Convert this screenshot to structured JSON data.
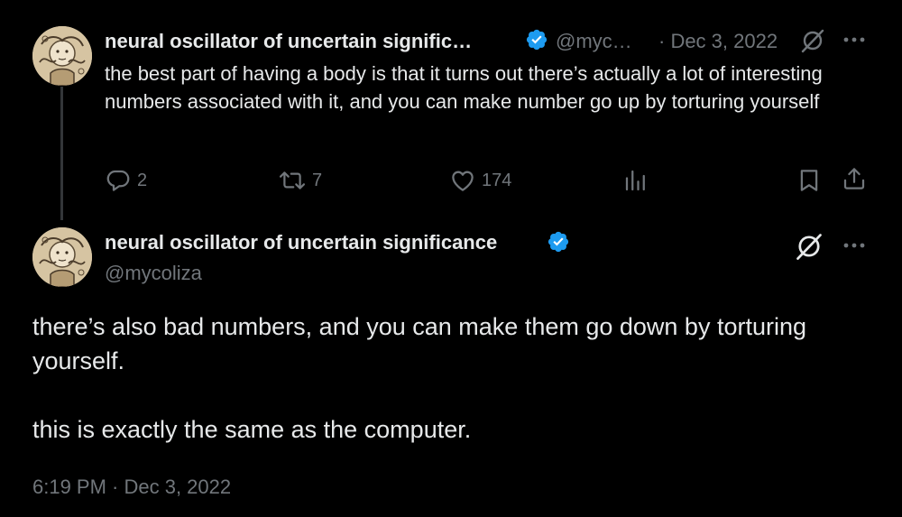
{
  "parent_tweet": {
    "display_name": "neural oscillator of uncertain signific…",
    "handle": "@myc…",
    "date": "· Dec 3, 2022",
    "text": "the best part of having a body is that it turns out there’s actually a lot of interesting numbers associated with it, and you can make number go up by torturing yourself",
    "replies": "2",
    "retweets": "7",
    "likes": "174",
    "views": ""
  },
  "main_tweet": {
    "display_name": "neural oscillator of uncertain significance",
    "handle": "@mycoliza",
    "paragraphs": [
      "there’s also bad numbers, and you can make them go down by torturing yourself.",
      "this is exactly the same as the computer."
    ],
    "timestamp": "6:19 PM · Dec 3, 2022"
  },
  "colors": {
    "background": "#000000",
    "text_primary": "#e7e9ea",
    "text_secondary": "#71767b",
    "verified": "#1d9bf0",
    "thread_line": "#333639"
  },
  "icons": {
    "verified": "verified-badge-icon",
    "grok": "grok-icon",
    "more": "more-icon",
    "reply": "reply-icon",
    "retweet": "retweet-icon",
    "like": "like-icon",
    "views": "views-icon",
    "bookmark": "bookmark-icon",
    "share": "share-icon"
  }
}
